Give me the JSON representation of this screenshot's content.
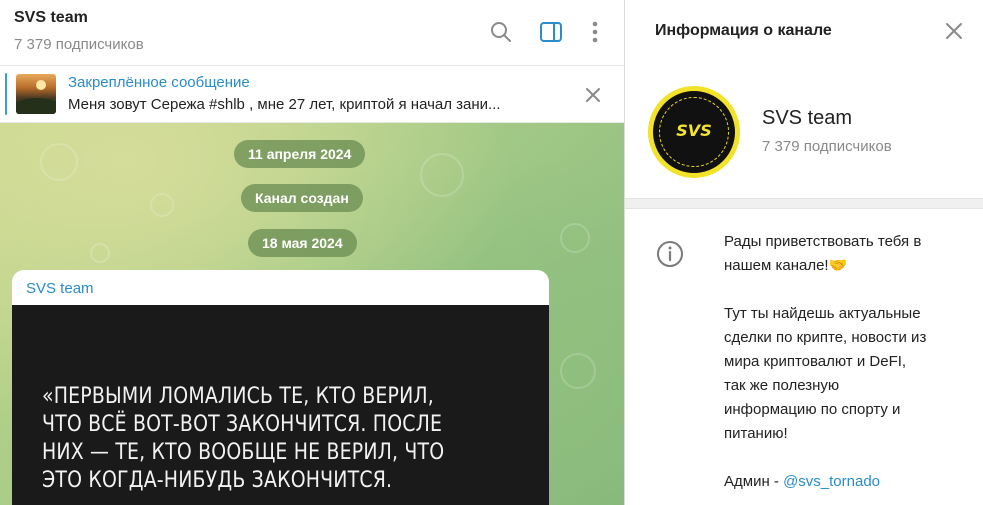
{
  "chat": {
    "title": "SVS team",
    "subscribers": "7 379 подписчиков",
    "pinned": {
      "title": "Закреплённое сообщение",
      "text": "Меня зовут Сережа #shlb , мне 27 лет, криптой я начал зани..."
    },
    "date_pills": [
      "11 апреля 2024",
      "Канал создан",
      "18 мая 2024"
    ],
    "message": {
      "author": "SVS team",
      "quote": "«Первыми ломались те, кто верил, что всё вот-вот закончится. После них — те, кто вообще не верил, что это когда-нибудь закончится."
    }
  },
  "info": {
    "title": "Информация о канале",
    "avatar_text": "SVS",
    "name": "SVS team",
    "subscribers": "7 379 подписчиков",
    "about_p1_line1": "Рады приветствовать тебя в",
    "about_p1_line2": "нашем канале!🤝",
    "about_p2": [
      "Тут ты найдешь актуальные",
      "сделки по крипте, новости из",
      "мира криптовалют и DeFI,",
      "так же полезную",
      "информацию по спорту и",
      "питанию!"
    ],
    "admin_label": "Админ - ",
    "admin_link": "@svs_tornado"
  },
  "icons": [
    "search-icon",
    "sidebar-toggle-icon",
    "more-vertical-icon",
    "close-icon",
    "info-icon"
  ],
  "colors": {
    "accent": "#2a8cc9",
    "pill_bg": "#6a8c52",
    "avatar_yellow": "#f2e22a"
  }
}
